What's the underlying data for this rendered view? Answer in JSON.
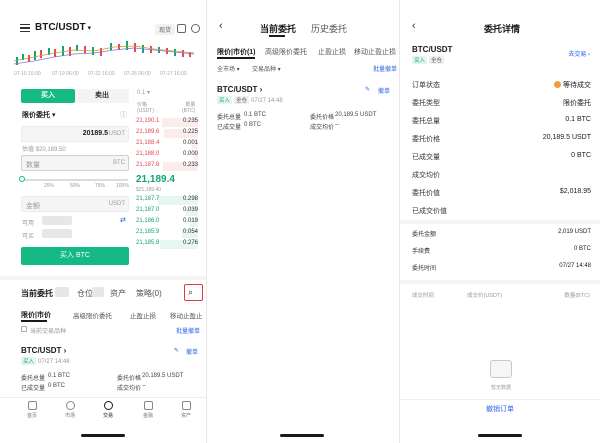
{
  "colors": {
    "buy": "#15b985",
    "sell": "#e5484d",
    "link": "#2a63e6",
    "warn": "#f59b3a",
    "highlight": "#e23b3b"
  },
  "screen1": {
    "symbol": "BTC/USDT",
    "tag_now": "现货",
    "chart_dates": [
      "07-15 16:00",
      "07-19 06:00",
      "07-22 16:00",
      "07-26 06:00",
      "07-27 16:00"
    ],
    "side_tabs": {
      "buy": "买入",
      "sell": "卖出"
    },
    "order_type": "限价委托",
    "price": {
      "value": "20189.5",
      "unit": "USDT"
    },
    "valuation": "估值 $20,189.50",
    "qty": {
      "placeholder": "数量",
      "unit": "BTC"
    },
    "pct_marks": [
      "25%",
      "50%",
      "75%",
      "100%"
    ],
    "amount": {
      "placeholder": "金额",
      "unit": "USDT"
    },
    "avail_label": "可用",
    "buyable_label": "可买",
    "buy_button": "买入 BTC",
    "orderbook": {
      "step": "0.1",
      "col_price": "价格\n(USDT)",
      "col_qty": "数量\n(BTC)",
      "asks": [
        {
          "price": "21,190.1",
          "qty": "0.235"
        },
        {
          "price": "21,189.6",
          "qty": "0.225"
        },
        {
          "price": "21,188.4",
          "qty": "0.001"
        },
        {
          "price": "21,188.0",
          "qty": "0.000"
        },
        {
          "price": "21,187.8",
          "qty": "0.233"
        }
      ],
      "last": "21,189.4",
      "last_sub": "$21,189.40",
      "bids": [
        {
          "price": "21,187.7",
          "qty": "0.298"
        },
        {
          "price": "21,187.0",
          "qty": "0.039"
        },
        {
          "price": "21,186.0",
          "qty": "0.019"
        },
        {
          "price": "21,185.9",
          "qty": "0.054"
        },
        {
          "price": "21,185.8",
          "qty": "0.276"
        }
      ]
    },
    "bottom_tabs": [
      "当前委托",
      "仓位",
      "资产",
      "策略(0)"
    ],
    "order_subtabs": [
      "限价|市价",
      "高级限价委托",
      "止盈止损",
      "移动止盈止"
    ],
    "current_pair_only": "当前交易品种",
    "batch_cancel": "批量撤单",
    "order": {
      "symbol": "BTC/USDT",
      "side": "买入",
      "time": "07/27 14:48",
      "edit": "改单",
      "cancel": "撤单",
      "total_label": "委托总量",
      "total_value": "0.1 BTC",
      "price_label": "委托价格",
      "price_value": "20,189.5 USDT",
      "filled_label": "已成交量",
      "filled_value": "0 BTC",
      "avg_label": "成交均价",
      "avg_value": "--"
    },
    "nav": [
      "首页",
      "市场",
      "交易",
      "金融",
      "资产"
    ]
  },
  "screen2": {
    "tab_current": "当前委托",
    "tab_history": "历史委托",
    "subtabs": [
      "限价|市价(1)",
      "高级限价委托",
      "止盈止损",
      "移动止盈止损"
    ],
    "filter_type": "全市场",
    "filter_pair": "交易品种",
    "batch_cancel": "批量撤单",
    "order": {
      "symbol": "BTC/USDT",
      "side": "买入",
      "mode": "全仓",
      "time": "07/27 14:48",
      "cancel": "撤单",
      "total_label": "委托总量",
      "total_value": "0.1 BTC",
      "price_label": "委托价格",
      "price_value": "20,189.5 USDT",
      "filled_label": "已成交量",
      "filled_value": "0 BTC",
      "avg_label": "成交均价",
      "avg_value": "--"
    }
  },
  "screen3": {
    "title": "委托详情",
    "symbol": "BTC/USDT",
    "go_trade": "去交易",
    "side": "买入",
    "mode": "全仓",
    "rows": [
      {
        "label": "订单状态",
        "value": "等待成交"
      },
      {
        "label": "委托类型",
        "value": "限价委托"
      },
      {
        "label": "委托总量",
        "value": "0.1 BTC"
      },
      {
        "label": "委托价格",
        "value": "20,189.5 USDT"
      },
      {
        "label": "已成交量",
        "value": "0 BTC"
      },
      {
        "label": "成交均价",
        "value": ""
      },
      {
        "label": "委托价值",
        "value": "$2,018.95"
      },
      {
        "label": "已成交价值",
        "value": ""
      }
    ],
    "fee_rows": [
      {
        "label": "委托金额",
        "value": "2,019 USDT"
      },
      {
        "label": "手续费",
        "value": "0 BTC"
      },
      {
        "label": "委托时间",
        "value": "07/27 14:48"
      }
    ],
    "fills_head": [
      "成交时间",
      "成交价(USDT)",
      "数量(BTC)"
    ],
    "empty_text": "暂无数据",
    "cancel_order": "撤销订单"
  }
}
